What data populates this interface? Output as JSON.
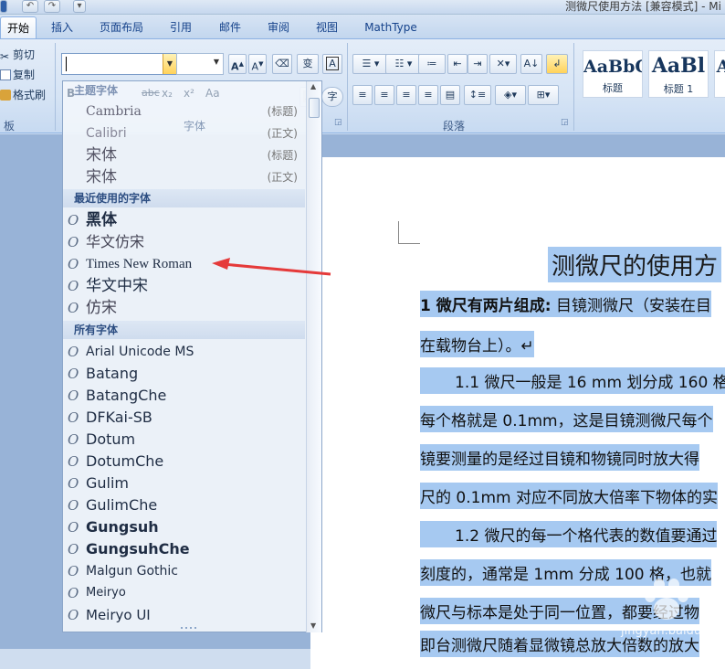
{
  "window": {
    "title": "测微尺使用方法 [兼容模式] - Mi"
  },
  "tabs": [
    {
      "label": "开始",
      "active": true
    },
    {
      "label": "插入"
    },
    {
      "label": "页面布局"
    },
    {
      "label": "引用"
    },
    {
      "label": "邮件"
    },
    {
      "label": "审阅"
    },
    {
      "label": "视图"
    },
    {
      "label": "MathType"
    }
  ],
  "clipboard": {
    "cut": "剪切",
    "copy": "复制",
    "format_painter": "格式刷",
    "group_label": "板"
  },
  "font_group": {
    "font_value": "",
    "group_label": "字体",
    "buttons": {
      "grow": "A",
      "shrink": "A",
      "phonetic": "变",
      "border_char": "A",
      "bold": "B",
      "strike": "abc",
      "sub": "x₂",
      "sup": "x²",
      "case": "Aa",
      "shade": "A",
      "enclose": "字"
    }
  },
  "paragraph_group": {
    "group_label": "段落"
  },
  "styles": [
    {
      "sample": "AaBbC",
      "name": "标题"
    },
    {
      "sample": "AaBl",
      "name": "标题 1"
    },
    {
      "sample": "A",
      "name": ""
    }
  ],
  "font_panel": {
    "theme_header": "主题字体",
    "theme_fonts": [
      {
        "name": "Cambria",
        "tag": "(标题)"
      },
      {
        "name": "Calibri",
        "tag": "(正文)"
      },
      {
        "name": "宋体",
        "tag": "(标题)"
      },
      {
        "name": "宋体",
        "tag": "(正文)"
      }
    ],
    "recent_header": "最近使用的字体",
    "recent_fonts": [
      "黑体",
      "华文仿宋",
      "Times New Roman",
      "华文中宋",
      "仿宋"
    ],
    "all_header": "所有字体",
    "all_fonts": [
      "Arial Unicode MS",
      "Batang",
      "BatangChe",
      "DFKai-SB",
      "Dotum",
      "DotumChe",
      "Gulim",
      "GulimChe",
      "Gungsuh",
      "GungsuhChe",
      "Malgun Gothic",
      "Meiryo",
      "Meiryo UI"
    ],
    "font_glyph": "O"
  },
  "document": {
    "heading": "测微尺的使用方",
    "lines": [
      {
        "bold": "1 微尺有两片组成:",
        "text": " 目镜测微尺（安装在目"
      },
      {
        "text": "在载物台上）。↵"
      },
      {
        "text": "1.1 微尺一般是 16 mm 划分成 160 格"
      },
      {
        "text": "每个格就是 0.1mm，这是目镜测微尺每个"
      },
      {
        "text": "镜要测量的是经过目镜和物镜同时放大得"
      },
      {
        "text": "尺的 0.1mm 对应不同放大倍率下物体的实"
      },
      {
        "text": "1.2 微尺的每一个格代表的数值要通过"
      },
      {
        "text": "刻度的，通常是 1mm 分成 100 格，也就"
      },
      {
        "text": "微尺与标本是处于同一位置，都要经过物"
      },
      {
        "text": "即台测微尺随着显微镜总放大倍数的放大"
      }
    ]
  },
  "watermark": "jingyan.baidu.com",
  "colors": {
    "accent": "#8db2e3",
    "selection": "#a6c9f1",
    "arrow": "#e53a3a"
  }
}
